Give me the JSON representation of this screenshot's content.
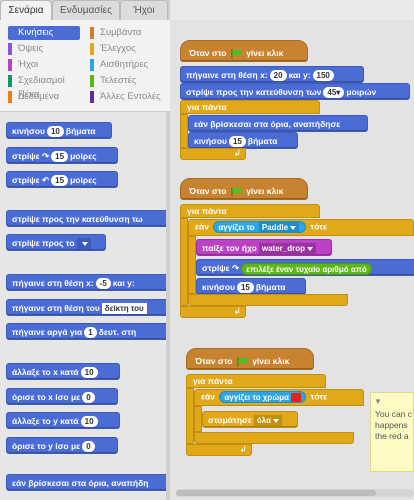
{
  "tabs": [
    "Σενάρια",
    "Ενδυμασίες",
    "Ήχοι"
  ],
  "categories": [
    {
      "label": "Κινήσεις",
      "color": "#4a6cd4",
      "selected": true
    },
    {
      "label": "Όψεις",
      "color": "#8a55d7"
    },
    {
      "label": "Ήχοι",
      "color": "#bb42c3"
    },
    {
      "label": "Σχεδιασμοί Πένα",
      "color": "#0e9a6c"
    },
    {
      "label": "Δεδομένα",
      "color": "#ee7d16"
    },
    {
      "label": "Συμβάντα",
      "color": "#c88330"
    },
    {
      "label": "Έλεγχος",
      "color": "#e1a91a"
    },
    {
      "label": "Αισθητήρες",
      "color": "#2ca5e2"
    },
    {
      "label": "Τελεστές",
      "color": "#5cb712"
    },
    {
      "label": "Άλλες Εντολές",
      "color": "#632d99"
    }
  ],
  "palette": {
    "move": "κινήσου",
    "move_n": "10",
    "move_suffix": "βήματα",
    "turn_right": "στρίψε",
    "turn_right_n": "15",
    "turn_right_suffix": "μοίρες",
    "turn_left": "στρίψε",
    "turn_left_n": "15",
    "turn_left_suffix": "μοίρες",
    "point_dir": "στρίψε προς την κατεύθυνση τω",
    "point_towards": "στρίψε προς το",
    "goto_xy": "πήγαινε στη θέση x:",
    "goto_x": "-5",
    "goto_y_label": "και y:",
    "goto_target": "πήγαινε στη θέση του",
    "goto_target_val": "δείκτη του",
    "glide": "πήγαινε αργά για",
    "glide_n": "1",
    "glide_rest": "δευτ. στη",
    "change_x": "άλλαξε το x κατά",
    "change_x_n": "10",
    "set_x": "όρισε το x ίσο με",
    "set_x_n": "0",
    "change_y": "άλλαξε το y κατά",
    "change_y_n": "10",
    "set_y": "όρισε το y ίσο με",
    "set_y_n": "0",
    "bounce": "εάν βρίσκεσαι στα όρια, αναπήδη"
  },
  "script1": {
    "hat": "Όταν στο",
    "hat2": "γίνει κλικ",
    "goto": "πήγαινε στη θέση x:",
    "x": "20",
    "y_label": "και y:",
    "y": "150",
    "point": "στρίψε προς την κατεύθυνση των",
    "dir": "45▾",
    "dir_suffix": "μοιρών",
    "forever": "για πάντα",
    "bounce": "εάν βρίσκεσαι στα όρια, αναπήδησε",
    "move": "κινήσου",
    "move_n": "15",
    "move_suffix": "βήματα"
  },
  "script2": {
    "hat": "Όταν στο",
    "hat2": "γίνει κλικ",
    "forever": "για πάντα",
    "if": "εάν",
    "touching": "αγγίζει το",
    "touching_target": "Paddle",
    "then": "τότε",
    "play": "παίξε τον ήχο",
    "sound": "water_drop",
    "turn": "στρίψε",
    "random": "επιλέξε έναν τυχαίο αριθμό από",
    "move": "κινήσου",
    "move_n": "15",
    "move_suffix": "βήματα"
  },
  "script3": {
    "hat": "Όταν στο",
    "hat2": "γίνει κλικ",
    "forever": "για πάντα",
    "if": "εάν",
    "touching_color": "αγγίζει το χρώμα",
    "then": "τότε",
    "stop": "σταμάτησε",
    "stop_opt": "όλα"
  },
  "note": "You can c happens the red a",
  "accent_colors": {
    "motion": "#4a6cd4",
    "control": "#e1a91a",
    "events": "#c88330",
    "sound": "#bb42c3",
    "sensing": "#2ca5e2",
    "operators": "#5cb712"
  }
}
